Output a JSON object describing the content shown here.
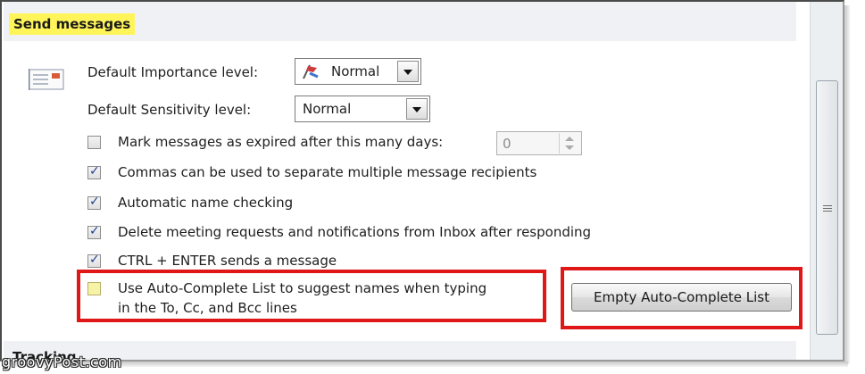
{
  "section": {
    "title": "Send messages",
    "tracking_label": "Tracking"
  },
  "watermark": "groovyPost.com",
  "importance": {
    "label": "Default Importance level:",
    "value": "Normal"
  },
  "sensitivity": {
    "label": "Default Sensitivity level:",
    "value": "Normal"
  },
  "options": [
    {
      "label": "Mark messages as expired after this many days:",
      "checked": false
    },
    {
      "label": "Commas can be used to separate multiple message recipients",
      "checked": true
    },
    {
      "label": "Automatic name checking",
      "checked": true
    },
    {
      "label": "Delete meeting requests and notifications from Inbox after responding",
      "checked": true
    },
    {
      "label": "CTRL + ENTER sends a message",
      "checked": true
    },
    {
      "label_line1": "Use Auto-Complete List to suggest names when typing",
      "label_line2": "in the To, Cc, and Bcc lines",
      "checked": false
    }
  ],
  "expire_days": {
    "value": "0"
  },
  "empty_button": {
    "label": "Empty Auto-Complete List"
  },
  "colors": {
    "highlight": "#fff55a",
    "callout": "#e01717",
    "header_band": "#eff1f5"
  },
  "icons": {
    "send": "message-lines-icon",
    "importance": "importance-flag-icon",
    "dropdown": "chevron-down-icon"
  }
}
